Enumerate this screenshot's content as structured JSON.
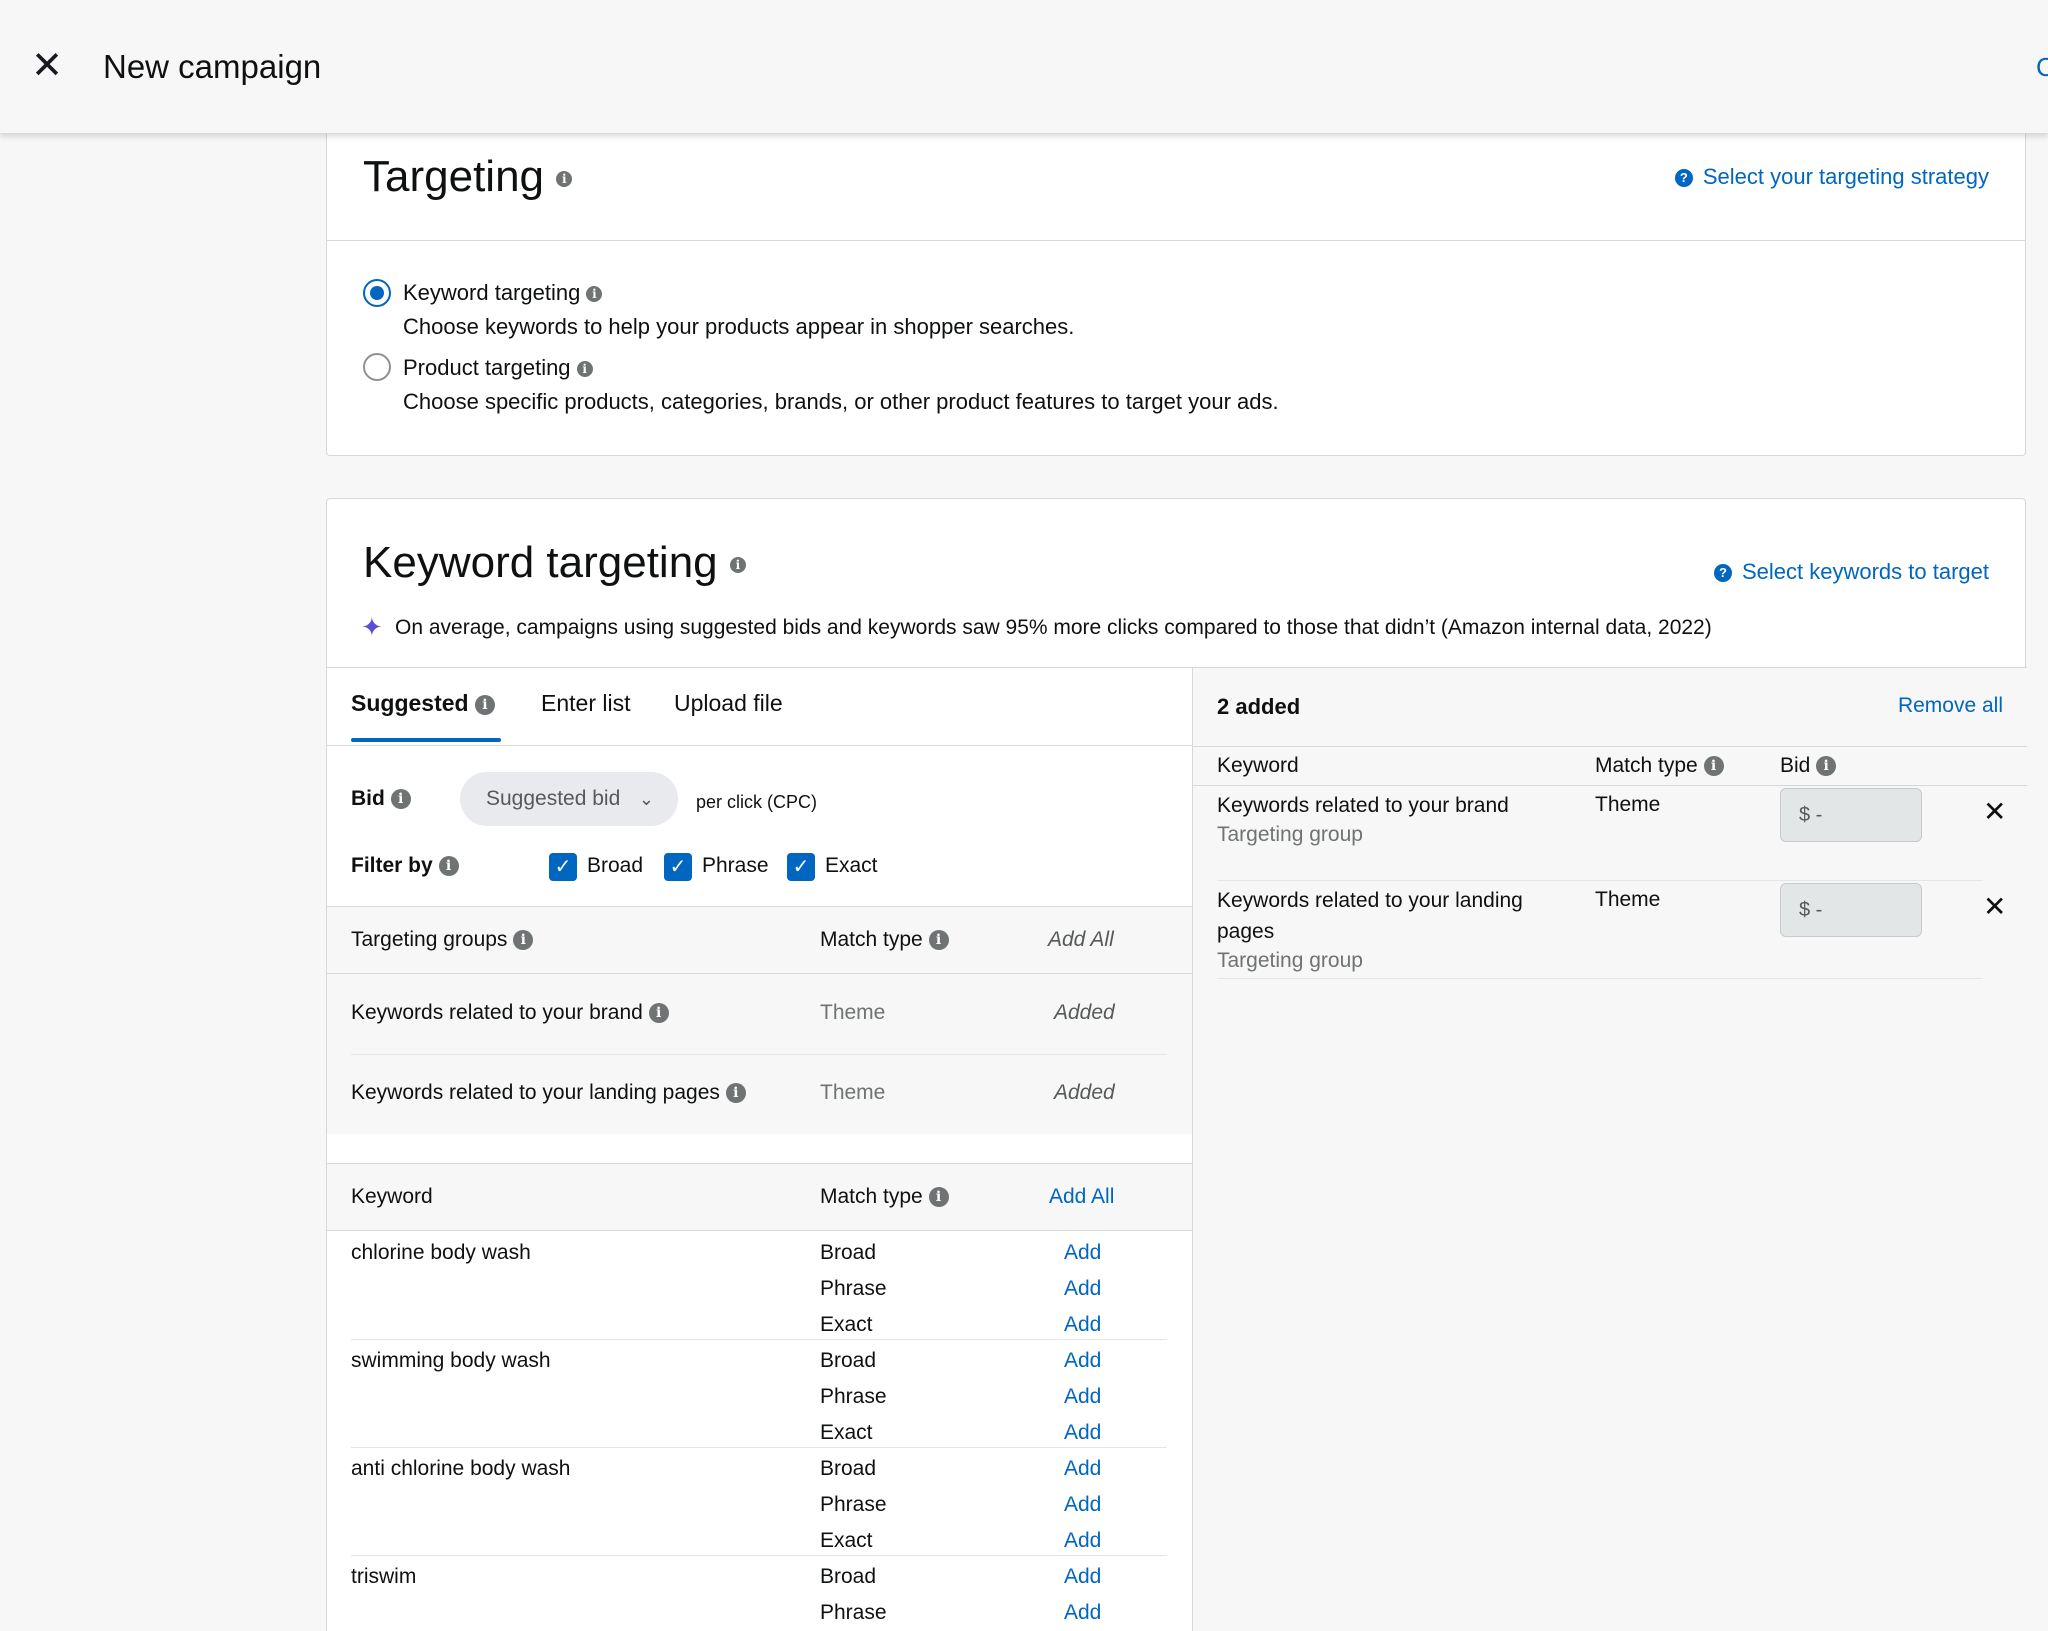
{
  "header": {
    "close_icon": "close-icon",
    "title": "New campaign",
    "edge_text": "C"
  },
  "targeting": {
    "title": "Targeting",
    "help_link": "Select your targeting strategy",
    "options": [
      {
        "label": "Keyword targeting",
        "description": "Choose keywords to help your products appear in shopper searches.",
        "selected": true
      },
      {
        "label": "Product targeting",
        "description": "Choose specific products, categories, brands, or other product features to target your ads.",
        "selected": false
      }
    ]
  },
  "keyword_targeting": {
    "title": "Keyword targeting",
    "help_link": "Select keywords to target",
    "notice": "On average, campaigns using suggested bids and keywords saw 95% more clicks compared to those that didn’t (Amazon internal data, 2022)",
    "tabs": [
      "Suggested",
      "Enter list",
      "Upload file"
    ],
    "active_tab": "Suggested",
    "bid_label": "Bid",
    "bid_select": "Suggested bid",
    "bid_unit": "per click (CPC)",
    "filter_label": "Filter by",
    "filters": [
      {
        "label": "Broad",
        "checked": true
      },
      {
        "label": "Phrase",
        "checked": true
      },
      {
        "label": "Exact",
        "checked": true
      }
    ],
    "groups_table": {
      "col_group": "Targeting groups",
      "col_match": "Match type",
      "col_action": "Add All",
      "rows": [
        {
          "name": "Keywords related to your brand",
          "match": "Theme",
          "status": "Added"
        },
        {
          "name": "Keywords related to your landing pages",
          "match": "Theme",
          "status": "Added"
        }
      ]
    },
    "keywords_table": {
      "col_keyword": "Keyword",
      "col_match": "Match type",
      "col_action": "Add All",
      "add_label": "Add",
      "rows": [
        {
          "keyword": "chlorine body wash",
          "matches": [
            "Broad",
            "Phrase",
            "Exact"
          ]
        },
        {
          "keyword": "swimming body wash",
          "matches": [
            "Broad",
            "Phrase",
            "Exact"
          ]
        },
        {
          "keyword": "anti chlorine body wash",
          "matches": [
            "Broad",
            "Phrase",
            "Exact"
          ]
        },
        {
          "keyword": "triswim",
          "matches": [
            "Broad",
            "Phrase"
          ]
        }
      ]
    },
    "added_panel": {
      "count_label": "2 added",
      "remove_all": "Remove all",
      "col_keyword": "Keyword",
      "col_match": "Match type",
      "col_bid": "Bid",
      "rows": [
        {
          "keyword": "Keywords related to your brand",
          "sub": "Targeting group",
          "match": "Theme",
          "bid": "$  -"
        },
        {
          "keyword": "Keywords related to your landing pages",
          "sub": "Targeting group",
          "match": "Theme",
          "bid": "$  -"
        }
      ]
    }
  },
  "colors": {
    "link": "#0066c0",
    "background": "#f7f7f7",
    "border": "#d5d9d9",
    "sparkle": "#5b4fd9"
  }
}
